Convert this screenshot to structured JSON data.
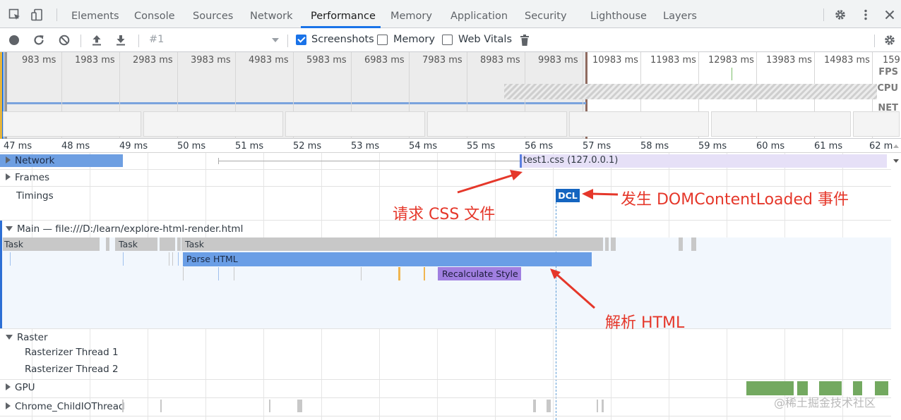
{
  "tabs": {
    "items": [
      "Elements",
      "Console",
      "Sources",
      "Network",
      "Performance",
      "Memory",
      "Application",
      "Security",
      "Lighthouse",
      "Layers"
    ],
    "active": "Performance"
  },
  "toolbar": {
    "profile_select": "#1",
    "screenshots_label": "Screenshots",
    "screenshots_checked": true,
    "memory_label": "Memory",
    "memory_checked": false,
    "web_vitals_label": "Web Vitals",
    "web_vitals_checked": false
  },
  "overview": {
    "ticks": [
      "983 ms",
      "1983 ms",
      "2983 ms",
      "3983 ms",
      "4983 ms",
      "5983 ms",
      "6983 ms",
      "7983 ms",
      "8983 ms",
      "9983 ms",
      "10983 ms",
      "11983 ms",
      "12983 ms",
      "13983 ms",
      "14983 ms",
      "159"
    ],
    "fps_label": "FPS",
    "cpu_label": "CPU",
    "net_label": "NET"
  },
  "ruler": {
    "ticks": [
      "47 ms",
      "48 ms",
      "49 ms",
      "50 ms",
      "51 ms",
      "52 ms",
      "53 ms",
      "54 ms",
      "55 ms",
      "56 ms",
      "57 ms",
      "58 ms",
      "59 ms",
      "60 ms",
      "61 ms",
      "62 m"
    ]
  },
  "tracks": {
    "network": "Network",
    "network_request": "test1.css (127.0.0.1)",
    "frames": "Frames",
    "timings": "Timings",
    "dcl": "DCL",
    "main": "Main — file:///D:/learn/explore-html-render.html",
    "task1": "Task",
    "task2": "Task",
    "task3": "Task",
    "parse_html": "Parse HTML",
    "recalc_style": "Recalculate Style",
    "raster": "Raster",
    "raster_thread_1": "Rasterizer Thread 1",
    "raster_thread_2": "Rasterizer Thread 2",
    "gpu": "GPU",
    "child_io": "Chrome_ChildIOThread"
  },
  "annotations": {
    "request_css": "请求 CSS 文件",
    "dcl_event": "发生 DOMContentLoaded 事件",
    "parse_html": "解析 HTML"
  },
  "watermark": "@稀土掘金技术社区",
  "colors": {
    "accent": "#1a73e8",
    "parse_html": "#6a9ee6",
    "recalc_style": "#a07fe0",
    "task": "#c8c8c8",
    "dcl": "#1565c0",
    "gpu": "#73a960",
    "annotation": "#e5372a"
  }
}
